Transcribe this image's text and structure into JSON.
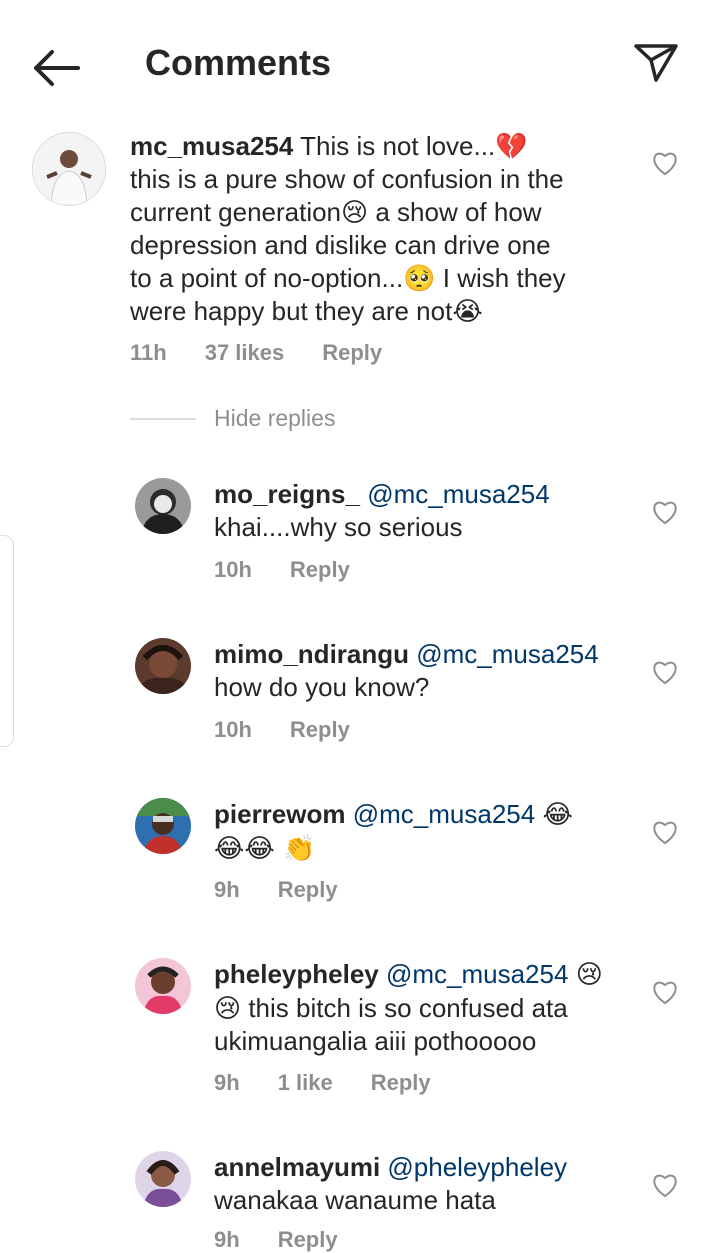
{
  "header": {
    "title": "Comments",
    "back_icon": "arrow-left-icon",
    "send_icon": "paper-plane-icon"
  },
  "comments": [
    {
      "username": "mc_musa254",
      "mention": "",
      "lines": [
        "This is not love...💔",
        "this is a pure show of confusion in the",
        "current generation😢 a show of how",
        "depression and dislike can drive one",
        "to a point of no-option...🥺 I wish they",
        "were happy but they are not😭"
      ],
      "time": "11h",
      "likes": "37 likes",
      "reply": "Reply"
    },
    {
      "username": "mo_reigns_",
      "mention": "@mc_musa254",
      "lines": [
        "",
        "khai....why so serious"
      ],
      "time": "10h",
      "likes": "",
      "reply": "Reply"
    },
    {
      "username": "mimo_ndirangu",
      "mention": "@mc_musa254",
      "lines": [
        "",
        "how do you know?"
      ],
      "time": "10h",
      "likes": "",
      "reply": "Reply"
    },
    {
      "username": "pierrewom",
      "mention": "@mc_musa254",
      "lines": [
        "😂",
        "😂😂 👏"
      ],
      "time": "9h",
      "likes": "",
      "reply": "Reply"
    },
    {
      "username": "pheleypheley",
      "mention": "@mc_musa254",
      "lines": [
        "😢",
        "😢 this bitch is so confused ata",
        "ukimuangalia aiii pothooooo"
      ],
      "time": "9h",
      "likes": "1 like",
      "reply": "Reply"
    },
    {
      "username": "annelmayumi",
      "mention": "@pheleypheley",
      "lines": [
        "",
        "wanakaa wanaume hata"
      ],
      "time": "9h",
      "likes": "",
      "reply": "Reply"
    }
  ],
  "hide_replies": "Hide replies",
  "colors": {
    "text": "#262626",
    "mention": "#00376b",
    "muted": "#8e8e8e"
  }
}
